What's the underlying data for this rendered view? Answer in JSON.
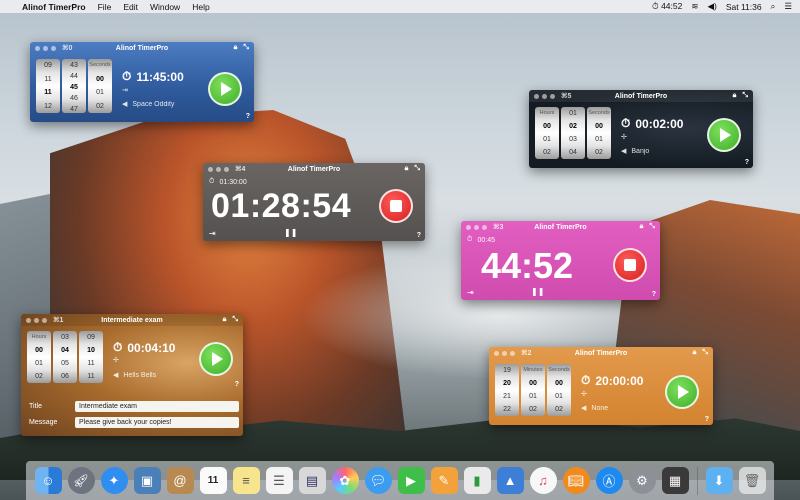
{
  "menubar": {
    "app_name": "Alinof TimerPro",
    "menus": [
      "File",
      "Edit",
      "Window",
      "Help"
    ],
    "timer_status": "44:52",
    "clock": "Sat 11:36"
  },
  "windows": {
    "w0": {
      "shortcut": "⌘0",
      "title": "Alinof TimerPro",
      "wheels": [
        [
          "09",
          "11",
          "12",
          "13"
        ],
        [
          "43",
          "44",
          "45",
          "46",
          "47"
        ],
        [
          "",
          "00",
          "01",
          "02"
        ]
      ],
      "wheel_headers": [
        "",
        "",
        "Seconds"
      ],
      "selected": [
        "11",
        "45",
        "00"
      ],
      "time": "11:45:00",
      "sound": "Space Oddity",
      "help": "?"
    },
    "w5": {
      "shortcut": "⌘5",
      "title": "Alinof TimerPro",
      "wheel_headers": [
        "Hours",
        "Minutes",
        "Seconds"
      ],
      "wheels": [
        [
          "",
          "00",
          "01",
          "02"
        ],
        [
          "01",
          "02",
          "03",
          "04"
        ],
        [
          "",
          "00",
          "01",
          "02"
        ]
      ],
      "selected": [
        "00",
        "02",
        "00"
      ],
      "time": "00:02:00",
      "sound": "Banjo",
      "help": "?"
    },
    "w4": {
      "shortcut": "⌘4",
      "title": "Alinof TimerPro",
      "set_time": "01:30:00",
      "countdown": "01:28:54",
      "help": "?"
    },
    "w3": {
      "shortcut": "⌘3",
      "title": "Alinof TimerPro",
      "set_time": "00:45",
      "countdown": "44:52",
      "help": "?"
    },
    "w1": {
      "shortcut": "⌘1",
      "title": "Intermediate exam",
      "wheel_headers": [
        "Hours",
        "Minutes",
        "Seconds"
      ],
      "wheels": [
        [
          "",
          "00",
          "01",
          "02"
        ],
        [
          "03",
          "04",
          "05",
          "06"
        ],
        [
          "",
          "09",
          "10",
          "11"
        ]
      ],
      "selected": [
        "00",
        "04",
        "10"
      ],
      "time": "00:04:10",
      "sound": "Hells Bells",
      "form_title_label": "Title",
      "form_title_value": "Intermediate exam",
      "form_message_label": "Message",
      "form_message_value": "Please give back your copies!",
      "help": "?"
    },
    "w2": {
      "shortcut": "⌘2",
      "title": "Alinof TimerPro",
      "wheel_headers": [
        "Hours",
        "Minutes",
        "Seconds"
      ],
      "wheels": [
        [
          "19",
          "20",
          "21",
          "22"
        ],
        [
          "",
          "00",
          "01",
          "02"
        ],
        [
          "",
          "00",
          "01",
          "02"
        ]
      ],
      "selected": [
        "20",
        "00",
        "00"
      ],
      "time": "20:00:00",
      "sound": "None",
      "help": "?"
    }
  },
  "colors": {
    "w0_bg": "#3d6bb0",
    "w5_bg": "#141b22",
    "w4_bg": "#5e5a57",
    "w3_bg": "#d957b8",
    "w1_bg": "#a86b2c",
    "w2_bg": "#d98b3a",
    "play": "#4cbf37",
    "stop": "#e23030"
  },
  "dock": {
    "icons": [
      "finder-icon",
      "launchpad-icon",
      "safari-icon",
      "preview-icon",
      "contacts-icon",
      "calendar-icon",
      "notes-icon",
      "reminders-icon",
      "keynote-icon",
      "photos-icon",
      "messages-icon",
      "facetime-icon",
      "pages-icon",
      "numbers-icon",
      "keynote-app-icon",
      "itunes-icon",
      "ibooks-icon",
      "app-store-icon",
      "system-preferences-icon",
      "timerpro-dock-icon",
      "downloads-folder-icon",
      "trash-icon"
    ],
    "calendar_day": "11"
  }
}
